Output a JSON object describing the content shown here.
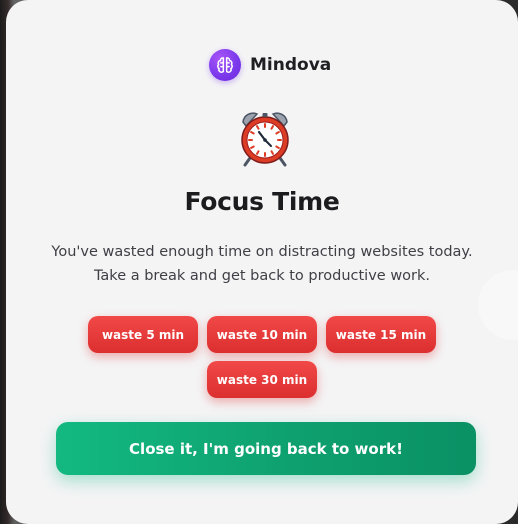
{
  "brand": {
    "name": "Mindova",
    "icon": "brain-icon",
    "color": "#7c3aed"
  },
  "hero_icon": "alarm-clock-icon",
  "title": "Focus Time",
  "message": {
    "line1": "You've wasted enough time on distracting websites today.",
    "line2": "Take a break and get back to productive work."
  },
  "waste_buttons": [
    {
      "label": "waste 5 min"
    },
    {
      "label": "waste 10 min"
    },
    {
      "label": "waste 15 min"
    },
    {
      "label": "waste 30 min"
    }
  ],
  "close_button": {
    "label": "Close it, I'm going back to work!"
  },
  "colors": {
    "waste": "#e53935",
    "primary": "#10b981",
    "card": "#f4f4f5"
  }
}
